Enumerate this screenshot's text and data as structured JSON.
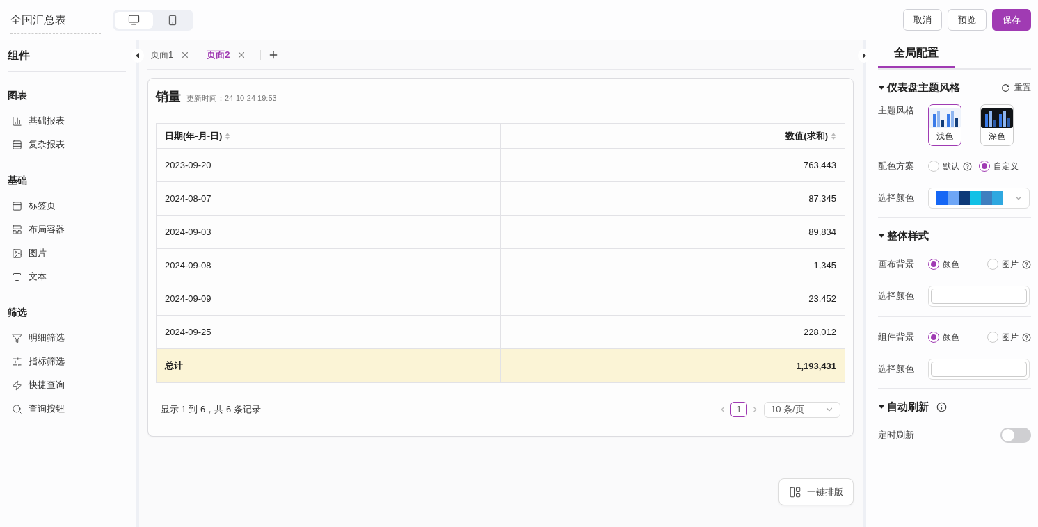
{
  "header": {
    "title": "全国汇总表",
    "devices": [
      {
        "kind": "desktop",
        "selected": true
      },
      {
        "kind": "mobile",
        "selected": false
      }
    ],
    "buttons": [
      {
        "label": "取消",
        "kind": "default"
      },
      {
        "label": "预览",
        "kind": "default"
      },
      {
        "label": "保存",
        "kind": "primary"
      }
    ]
  },
  "sidebar": {
    "title": "组件",
    "groups": [
      {
        "title": "图表",
        "items": [
          {
            "label": "基础报表",
            "kind": "chart"
          },
          {
            "label": "复杂报表",
            "kind": "table"
          }
        ]
      },
      {
        "title": "基础",
        "items": [
          {
            "label": "标签页",
            "kind": "tab"
          },
          {
            "label": "布局容器",
            "kind": "layout"
          },
          {
            "label": "图片",
            "kind": "image"
          },
          {
            "label": "文本",
            "kind": "text"
          }
        ]
      },
      {
        "title": "筛选",
        "items": [
          {
            "label": "明细筛选",
            "kind": "filter"
          },
          {
            "label": "指标筛选",
            "kind": "sliders"
          },
          {
            "label": "快捷查询",
            "kind": "quick"
          },
          {
            "label": "查询按钮",
            "kind": "search"
          }
        ]
      }
    ]
  },
  "tabs": [
    {
      "label": "页面1",
      "selected": false
    },
    {
      "label": "页面2",
      "selected": true
    }
  ],
  "card": {
    "title": "销量",
    "updated": "更新时间：24-10-24 19:53",
    "columns": [
      {
        "label": "日期(年-月-日)"
      },
      {
        "label": "数值(求和)"
      }
    ],
    "rows": [
      [
        "2023-09-20",
        "763,443"
      ],
      [
        "2024-08-07",
        "87,345"
      ],
      [
        "2024-09-03",
        "89,834"
      ],
      [
        "2024-09-08",
        "1,345"
      ],
      [
        "2024-09-09",
        "23,452"
      ],
      [
        "2024-09-25",
        "228,012"
      ]
    ],
    "total": [
      "总计",
      "1,193,431"
    ],
    "summary": "显示 1 到 6，共 6 条记录",
    "page": "1",
    "page_size": "10 条/页"
  },
  "auto_layout": "一键排版",
  "panel": {
    "tab": "全局配置",
    "sections": [
      {
        "title": "仪表盘主题风格",
        "expanded": true,
        "reset": "重置",
        "rows": [
          {
            "kind": "themes",
            "label": "主题风格",
            "options": [
              {
                "label": "浅色",
                "kind": "light",
                "selected": true
              },
              {
                "label": "深色",
                "kind": "dark",
                "selected": false
              }
            ]
          },
          {
            "kind": "radios",
            "label": "配色方案",
            "options": [
              {
                "label": "默认",
                "help": true,
                "selected": false
              },
              {
                "label": "自定义",
                "help": false,
                "selected": true
              }
            ]
          },
          {
            "kind": "palette",
            "label": "选择颜色",
            "colors": [
              {
                "color": "#1667f5"
              },
              {
                "color": "#6ea6f6"
              },
              {
                "color": "#0e3a78"
              },
              {
                "color": "#12c1e6"
              },
              {
                "color": "#3f7fbf"
              },
              {
                "color": "#2fa8e0"
              }
            ]
          }
        ]
      },
      {
        "title": "整体样式",
        "expanded": true,
        "rows": [
          {
            "kind": "radios",
            "label": "画布背景",
            "options": [
              {
                "label": "颜色",
                "help": false,
                "selected": true
              },
              {
                "label": "图片",
                "help": true,
                "selected": false
              }
            ]
          },
          {
            "kind": "color",
            "label": "选择颜色"
          },
          {
            "kind": "divider"
          },
          {
            "kind": "radios",
            "label": "组件背景",
            "options": [
              {
                "label": "颜色",
                "help": false,
                "selected": true
              },
              {
                "label": "图片",
                "help": true,
                "selected": false
              }
            ]
          },
          {
            "kind": "color",
            "label": "选择颜色"
          }
        ]
      },
      {
        "title": "自动刷新",
        "expanded": true,
        "info": true,
        "rows": [
          {
            "kind": "switch",
            "label": "定时刷新",
            "on": false
          }
        ]
      }
    ]
  }
}
